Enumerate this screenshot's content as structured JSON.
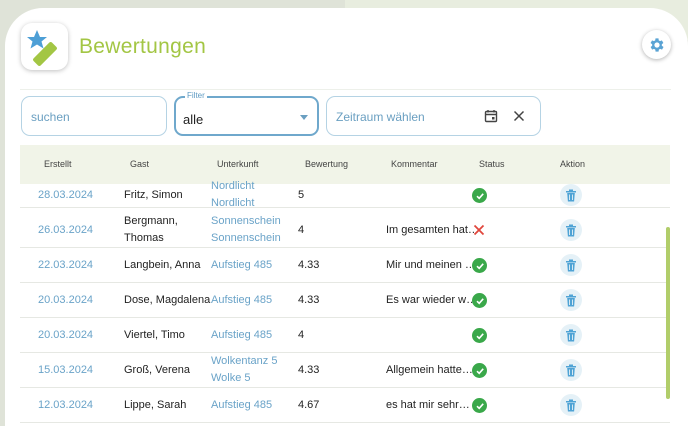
{
  "header": {
    "title": "Bewertungen",
    "logo_icon": "star-pencil-logo-icon",
    "settings_icon": "gear-icon"
  },
  "filters": {
    "search": {
      "placeholder": "suchen",
      "value": ""
    },
    "filter": {
      "label": "Filter",
      "value": "alle"
    },
    "date_range": {
      "placeholder": "Zeitraum wählen",
      "calendar_icon": "calendar-icon",
      "clear_icon": "close-icon"
    }
  },
  "table": {
    "columns": [
      "Erstellt",
      "Gast",
      "Unterkunft",
      "Bewertung",
      "Kommentar",
      "Status",
      "Aktion"
    ],
    "rows": [
      {
        "erstellt": "28.03.2024",
        "gast": [
          "Fritz, Simon"
        ],
        "unterkunft": [
          "Nordlicht",
          "Nordlicht"
        ],
        "bewertung": "5",
        "kommentar": "",
        "status": "approved"
      },
      {
        "erstellt": "26.03.2024",
        "gast": [
          "Bergmann,",
          "Thomas"
        ],
        "unterkunft": [
          "Sonnenschein",
          "Sonnenschein"
        ],
        "bewertung": "4",
        "kommentar": "Im gesamten hat…",
        "status": "rejected"
      },
      {
        "erstellt": "22.03.2024",
        "gast": [
          "Langbein, Anna"
        ],
        "unterkunft": [
          "Aufstieg 485"
        ],
        "bewertung": "4.33",
        "kommentar": "Mir und meinen …",
        "status": "approved"
      },
      {
        "erstellt": "20.03.2024",
        "gast": [
          "Dose, Magdalena"
        ],
        "unterkunft": [
          "Aufstieg 485"
        ],
        "bewertung": "4.33",
        "kommentar": "Es war wieder w…",
        "status": "approved"
      },
      {
        "erstellt": "20.03.2024",
        "gast": [
          "Viertel, Timo"
        ],
        "unterkunft": [
          "Aufstieg 485"
        ],
        "bewertung": "4",
        "kommentar": "",
        "status": "approved"
      },
      {
        "erstellt": "15.03.2024",
        "gast": [
          "Groß, Verena"
        ],
        "unterkunft": [
          "Wolkentanz 5",
          "Wolke 5"
        ],
        "bewertung": "4.33",
        "kommentar": "Allgemein hatte…",
        "status": "approved"
      },
      {
        "erstellt": "12.03.2024",
        "gast": [
          "Lippe, Sarah"
        ],
        "unterkunft": [
          "Aufstieg 485"
        ],
        "bewertung": "4.67",
        "kommentar": "es hat mir sehr…",
        "status": "approved"
      }
    ],
    "action_icon": "trash-icon"
  },
  "colors": {
    "accent_green": "#a3c644",
    "link_blue": "#6aa3c8",
    "status_ok": "#3aa84a",
    "status_rejected": "#e0463c"
  }
}
